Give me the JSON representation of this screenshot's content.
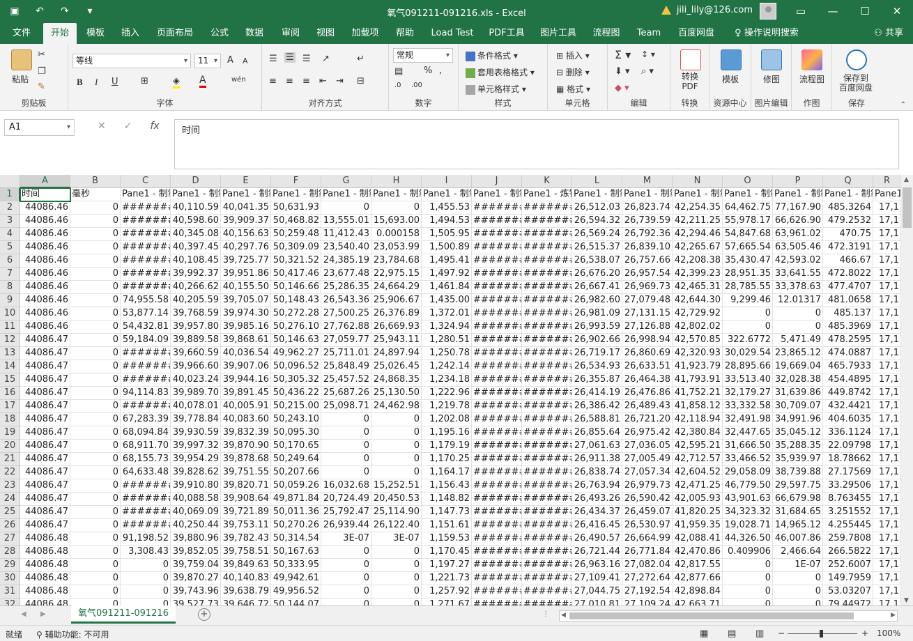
{
  "window": {
    "title": "氧气091211-091216.xls  -  Excel",
    "user_email": "jili_lily@126.com",
    "controls": {
      "ribbon_display": "▭",
      "minimize": "—",
      "maximize": "☐",
      "close": "✕"
    }
  },
  "menu_tabs": [
    "文件",
    "开始",
    "模板",
    "插入",
    "页面布局",
    "公式",
    "数据",
    "审阅",
    "视图",
    "加载项",
    "帮助",
    "Load Test",
    "PDF工具",
    "图片工具",
    "流程图",
    "Team",
    "百度网盘",
    "操作说明搜索"
  ],
  "menu_active": "开始",
  "share_label": "共享",
  "ribbon": {
    "clipboard": {
      "label": "剪贴板",
      "paste": "粘贴"
    },
    "font": {
      "label": "字体",
      "font_name": "等线",
      "font_size": "11",
      "bold": "B",
      "italic": "I",
      "underline": "U",
      "grow": "A",
      "shrink": "A",
      "phonetic": "wén"
    },
    "alignment": {
      "label": "对齐方式"
    },
    "number": {
      "label": "数字",
      "format": "常规",
      "percent": "%"
    },
    "styles": {
      "label": "样式",
      "conditional": "条件格式",
      "table": "套用表格格式",
      "cell": "单元格样式"
    },
    "cells": {
      "label": "单元格",
      "insert": "插入",
      "delete": "删除",
      "format": "格式"
    },
    "editing": {
      "label": "编辑"
    },
    "convert": {
      "label": "转换",
      "button": "转换\nPDF",
      "line1": "转换",
      "line2": "PDF"
    },
    "resource": {
      "label": "资源中心",
      "button": "模板"
    },
    "image_edit": {
      "label": "图片编辑",
      "button": "修图"
    },
    "draw": {
      "label": "作图",
      "button": "流程图"
    },
    "save": {
      "label": "保存",
      "line1": "保存到",
      "line2": "百度网盘"
    }
  },
  "formula_bar": {
    "name_box": "A1",
    "fx": "fx",
    "content": "时间"
  },
  "columns": [
    "A",
    "B",
    "C",
    "D",
    "E",
    "F",
    "G",
    "H",
    "I",
    "J",
    "K",
    "L",
    "M",
    "N",
    "O",
    "P",
    "Q",
    "R"
  ],
  "header_row": [
    "时间",
    "毫秒",
    "Pane1 - 制氧",
    "Pane1 - 制氧",
    "Pane1 - 制氧",
    "Pane1 - 制氧",
    "Pane1 - 制氧",
    "Pane1 - 制氧",
    "Pane1 - 制氧",
    "Pane1 - 制氧",
    "Pane1 - 炼钢",
    "Pane1 - 制氧",
    "Pane1 - 制氧",
    "Pane1 - 制氧",
    "Pane1 - 制氧",
    "Pane1 - 制氧",
    "Pane1 - 制氧",
    "Pane1"
  ],
  "rows": [
    [
      "44086.46",
      "0",
      "#######",
      "40,110.59",
      "40,041.35",
      "50,631.93",
      "0",
      "0",
      "1,455.53",
      "#######",
      "#######",
      "26,512.03",
      "26,823.74",
      "42,254.35",
      "64,462.75",
      "77,167.90",
      "485.3264",
      "17,1"
    ],
    [
      "44086.46",
      "0",
      "#######",
      "40,598.60",
      "39,909.37",
      "50,468.82",
      "13,555.01",
      "15,693.00",
      "1,494.53",
      "#######",
      "#######",
      "26,594.32",
      "26,739.59",
      "42,211.25",
      "55,978.17",
      "66,626.90",
      "479.2532",
      "17,1"
    ],
    [
      "44086.46",
      "0",
      "#######",
      "40,345.08",
      "40,156.63",
      "50,259.48",
      "11,412.43",
      "0.000158",
      "1,505.95",
      "#######",
      "#######",
      "26,569.24",
      "26,792.36",
      "42,294.46",
      "54,847.68",
      "63,961.02",
      "470.75",
      "17,1"
    ],
    [
      "44086.46",
      "0",
      "#######",
      "40,397.45",
      "40,297.76",
      "50,309.09",
      "23,540.40",
      "23,053.99",
      "1,500.89",
      "#######",
      "#######",
      "26,515.37",
      "26,839.10",
      "42,265.67",
      "57,665.54",
      "63,505.46",
      "472.3191",
      "17,1"
    ],
    [
      "44086.46",
      "0",
      "#######",
      "40,108.45",
      "39,725.77",
      "50,321.52",
      "24,385.19",
      "23,784.68",
      "1,495.41",
      "#######",
      "#######",
      "26,538.07",
      "26,757.66",
      "42,208.38",
      "35,430.47",
      "42,593.02",
      "466.67",
      "17,1"
    ],
    [
      "44086.46",
      "0",
      "#######",
      "39,992.37",
      "39,951.86",
      "50,417.46",
      "23,677.48",
      "22,975.15",
      "1,497.92",
      "#######",
      "#######",
      "26,676.20",
      "26,957.54",
      "42,399.23",
      "28,951.35",
      "33,641.55",
      "472.8022",
      "17,1"
    ],
    [
      "44086.46",
      "0",
      "#######",
      "40,266.62",
      "40,155.50",
      "50,146.66",
      "25,286.35",
      "24,664.29",
      "1,461.84",
      "#######",
      "#######",
      "26,667.41",
      "26,969.73",
      "42,465.31",
      "28,785.55",
      "33,378.63",
      "477.4707",
      "17,1"
    ],
    [
      "44086.46",
      "0",
      "74,955.58",
      "40,205.59",
      "39,705.07",
      "50,148.43",
      "26,543.36",
      "25,906.67",
      "1,435.00",
      "#######",
      "#######",
      "26,982.60",
      "27,079.48",
      "42,644.30",
      "9,299.46",
      "12.01317",
      "481.0658",
      "17,1"
    ],
    [
      "44086.46",
      "0",
      "53,877.14",
      "39,768.59",
      "39,974.30",
      "50,272.28",
      "27,500.25",
      "26,376.89",
      "1,372.01",
      "#######",
      "#######",
      "26,981.09",
      "27,131.15",
      "42,729.92",
      "0",
      "0",
      "485.137",
      "17,1"
    ],
    [
      "44086.46",
      "0",
      "54,432.81",
      "39,957.80",
      "39,985.16",
      "50,276.10",
      "27,762.88",
      "26,669.93",
      "1,324.94",
      "#######",
      "#######",
      "26,993.59",
      "27,126.88",
      "42,802.02",
      "0",
      "0",
      "485.3969",
      "17,1"
    ],
    [
      "44086.47",
      "0",
      "59,184.09",
      "39,889.58",
      "39,868.61",
      "50,146.63",
      "27,059.77",
      "25,943.11",
      "1,280.51",
      "#######",
      "#######",
      "26,902.66",
      "26,998.94",
      "42,570.85",
      "322.6772",
      "5,471.49",
      "478.2595",
      "17,1"
    ],
    [
      "44086.47",
      "0",
      "#######",
      "39,660.59",
      "40,036.54",
      "49,962.27",
      "25,711.01",
      "24,897.94",
      "1,250.78",
      "#######",
      "#######",
      "26,719.17",
      "26,860.69",
      "42,320.93",
      "30,029.54",
      "23,865.12",
      "474.0887",
      "17,1"
    ],
    [
      "44086.47",
      "0",
      "#######",
      "39,966.60",
      "39,907.06",
      "50,096.52",
      "25,848.49",
      "25,026.45",
      "1,242.14",
      "#######",
      "#######",
      "26,534.93",
      "26,633.51",
      "41,923.79",
      "28,895.66",
      "19,669.04",
      "465.7933",
      "17,1"
    ],
    [
      "44086.47",
      "0",
      "#######",
      "40,023.24",
      "39,944.16",
      "50,305.32",
      "25,457.52",
      "24,868.35",
      "1,234.18",
      "#######",
      "#######",
      "26,355.87",
      "26,464.38",
      "41,793.91",
      "33,513.40",
      "32,028.38",
      "454.4895",
      "17,1"
    ],
    [
      "44086.47",
      "0",
      "94,114.83",
      "39,989.70",
      "39,891.45",
      "50,436.22",
      "25,687.26",
      "25,130.50",
      "1,222.96",
      "#######",
      "#######",
      "26,414.19",
      "26,476.86",
      "41,752.21",
      "32,179.27",
      "31,639.86",
      "449.8742",
      "17,1"
    ],
    [
      "44086.47",
      "0",
      "#######",
      "40,078.01",
      "40,005.91",
      "50,215.00",
      "25,098.71",
      "24,462.98",
      "1,219.78",
      "#######",
      "#######",
      "26,386.42",
      "26,489.43",
      "41,858.12",
      "33,332.58",
      "30,709.07",
      "432.4421",
      "17,1"
    ],
    [
      "44086.47",
      "0",
      "67,283.39",
      "39,778.84",
      "40,083.60",
      "50,243.10",
      "0",
      "0",
      "1,202.08",
      "#######",
      "#######",
      "26,588.81",
      "26,721.20",
      "42,118.94",
      "32,491.98",
      "34,991.96",
      "404.6035",
      "17,1"
    ],
    [
      "44086.47",
      "0",
      "68,094.84",
      "39,930.59",
      "39,832.39",
      "50,095.30",
      "0",
      "0",
      "1,195.16",
      "#######",
      "#######",
      "26,855.64",
      "26,975.42",
      "42,380.84",
      "32,447.65",
      "35,045.12",
      "336.1124",
      "17,1"
    ],
    [
      "44086.47",
      "0",
      "68,911.70",
      "39,997.32",
      "39,870.90",
      "50,170.65",
      "0",
      "0",
      "1,179.19",
      "#######",
      "#######",
      "27,061.63",
      "27,036.05",
      "42,595.21",
      "31,666.50",
      "35,288.35",
      "22.09798",
      "17,1"
    ],
    [
      "44086.47",
      "0",
      "68,155.73",
      "39,954.29",
      "39,878.68",
      "50,249.64",
      "0",
      "0",
      "1,170.25",
      "#######",
      "#######",
      "26,911.38",
      "27,005.49",
      "42,712.57",
      "33,466.52",
      "35,939.97",
      "18.78662",
      "17,1"
    ],
    [
      "44086.47",
      "0",
      "64,633.48",
      "39,828.62",
      "39,751.55",
      "50,207.66",
      "0",
      "0",
      "1,164.17",
      "#######",
      "#######",
      "26,838.74",
      "27,057.34",
      "42,604.52",
      "29,058.09",
      "38,739.88",
      "27.17569",
      "17,1"
    ],
    [
      "44086.47",
      "0",
      "#######",
      "39,910.80",
      "39,820.71",
      "50,059.26",
      "16,032.68",
      "15,252.51",
      "1,156.43",
      "#######",
      "#######",
      "26,763.94",
      "26,979.73",
      "42,471.25",
      "46,779.50",
      "29,597.75",
      "33.29506",
      "17,1"
    ],
    [
      "44086.47",
      "0",
      "#######",
      "40,088.58",
      "39,908.64",
      "49,871.84",
      "20,724.49",
      "20,450.53",
      "1,148.82",
      "#######",
      "#######",
      "26,493.26",
      "26,590.42",
      "42,005.93",
      "43,901.63",
      "66,679.98",
      "8.763455",
      "17,1"
    ],
    [
      "44086.47",
      "0",
      "#######",
      "40,069.09",
      "39,721.89",
      "50,011.36",
      "25,792.47",
      "25,114.90",
      "1,147.73",
      "#######",
      "#######",
      "26,434.37",
      "26,459.07",
      "41,820.25",
      "34,323.32",
      "31,684.65",
      "3.251552",
      "17,1"
    ],
    [
      "44086.47",
      "0",
      "#######",
      "40,250.44",
      "39,753.11",
      "50,270.26",
      "26,939.44",
      "26,122.40",
      "1,151.61",
      "#######",
      "#######",
      "26,416.45",
      "26,530.97",
      "41,959.35",
      "19,028.71",
      "14,965.12",
      "4.255445",
      "17,1"
    ],
    [
      "44086.48",
      "0",
      "91,198.52",
      "39,880.96",
      "39,782.43",
      "50,314.54",
      "3E-07",
      "3E-07",
      "1,159.53",
      "#######",
      "#######",
      "26,490.57",
      "26,664.99",
      "42,088.41",
      "44,326.50",
      "46,007.86",
      "259.7808",
      "17,1"
    ],
    [
      "44086.48",
      "0",
      "3,308.43",
      "39,852.05",
      "39,758.51",
      "50,167.63",
      "0",
      "0",
      "1,170.45",
      "#######",
      "#######",
      "26,721.44",
      "26,771.84",
      "42,470.86",
      "0.409906",
      "2,466.64",
      "266.5822",
      "17,1"
    ],
    [
      "44086.48",
      "0",
      "0",
      "39,759.04",
      "39,849.63",
      "50,333.95",
      "0",
      "0",
      "1,197.27",
      "#######",
      "#######",
      "26,963.16",
      "27,082.04",
      "42,817.55",
      "0",
      "1E-07",
      "252.6007",
      "17,1"
    ],
    [
      "44086.48",
      "0",
      "0",
      "39,870.27",
      "40,140.83",
      "49,942.61",
      "0",
      "0",
      "1,221.73",
      "#######",
      "#######",
      "27,109.41",
      "27,272.64",
      "42,877.66",
      "0",
      "0",
      "149.7959",
      "17,1"
    ],
    [
      "44086.48",
      "0",
      "0",
      "39,743.96",
      "39,638.79",
      "49,956.52",
      "0",
      "0",
      "1,257.92",
      "#######",
      "#######",
      "27,044.75",
      "27,192.54",
      "42,898.84",
      "0",
      "0",
      "53.03207",
      "17,1"
    ],
    [
      "44086.48",
      "0",
      "0",
      "39,527.73",
      "39,646.72",
      "50,144.07",
      "0",
      "0",
      "1,271.67",
      "#######",
      "#######",
      "27,010.81",
      "27,109.24",
      "42,663.71",
      "0",
      "0",
      "79.44972",
      "17,1"
    ]
  ],
  "sheet_tab": "氧气091211-091216",
  "status": {
    "ready": "就绪",
    "accessibility": "辅助功能: 不可用",
    "zoom": "100%",
    "zoom_minus": "−",
    "zoom_plus": "+"
  }
}
